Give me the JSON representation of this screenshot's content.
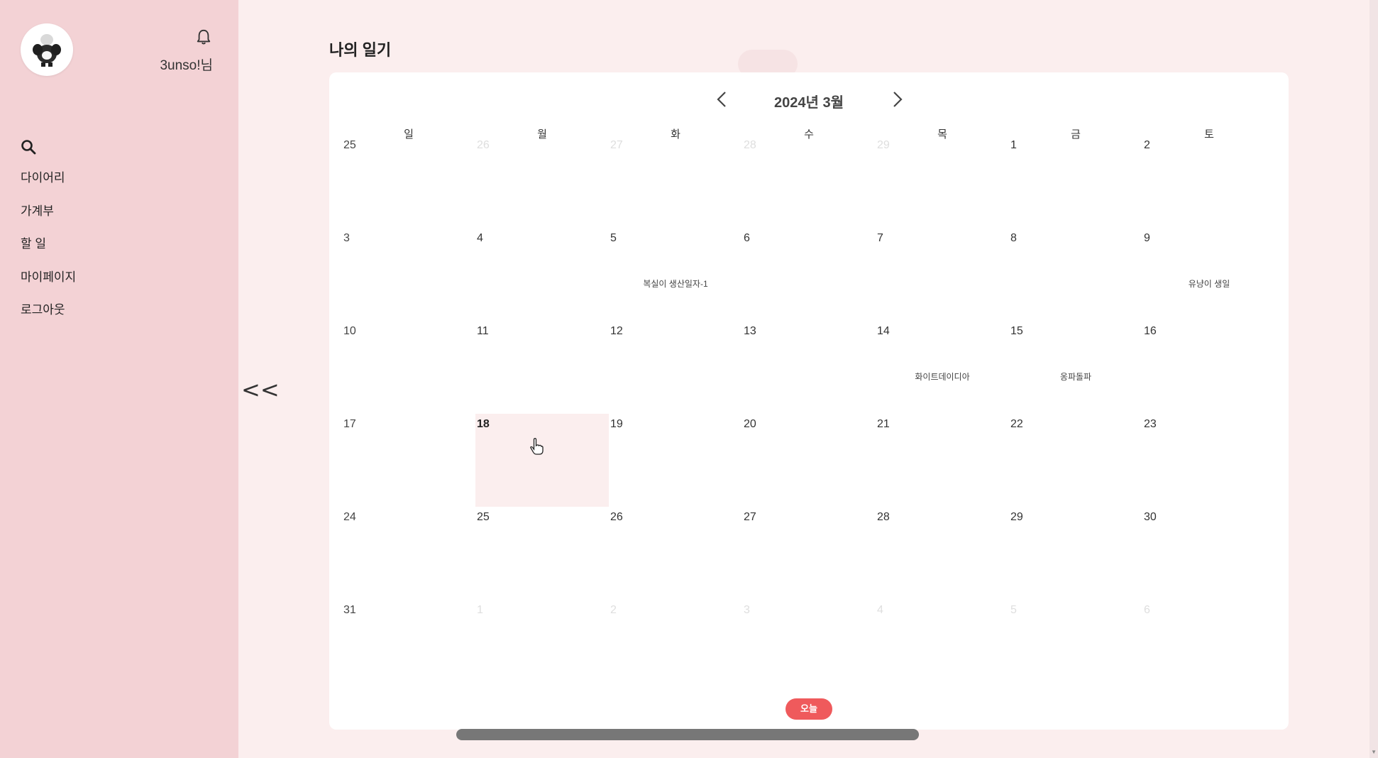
{
  "sidebar": {
    "username": "3unso!님",
    "menu": [
      {
        "label": "다이어리"
      },
      {
        "label": "가계부"
      },
      {
        "label": "할 일"
      },
      {
        "label": "마이페이지"
      },
      {
        "label": "로그아웃"
      }
    ]
  },
  "collapse_label": "<<",
  "page_title": "나의 일기",
  "calendar": {
    "month_label": "2024년 3월",
    "weekdays": [
      "일",
      "월",
      "화",
      "수",
      "목",
      "금",
      "토"
    ],
    "days": [
      {
        "d": "25",
        "muted": true
      },
      {
        "d": "26",
        "muted": true
      },
      {
        "d": "27",
        "muted": true
      },
      {
        "d": "28",
        "muted": true
      },
      {
        "d": "29",
        "muted": true
      },
      {
        "d": "1"
      },
      {
        "d": "2"
      },
      {
        "d": "3"
      },
      {
        "d": "4"
      },
      {
        "d": "5",
        "event": "복실이 생산일자-1"
      },
      {
        "d": "6"
      },
      {
        "d": "7"
      },
      {
        "d": "8"
      },
      {
        "d": "9",
        "event": "유냥이 생일"
      },
      {
        "d": "10"
      },
      {
        "d": "11"
      },
      {
        "d": "12"
      },
      {
        "d": "13"
      },
      {
        "d": "14",
        "event": "화이트데이디아"
      },
      {
        "d": "15",
        "event": "옹파돌파"
      },
      {
        "d": "16"
      },
      {
        "d": "17"
      },
      {
        "d": "18",
        "today": true
      },
      {
        "d": "19"
      },
      {
        "d": "20"
      },
      {
        "d": "21"
      },
      {
        "d": "22"
      },
      {
        "d": "23"
      },
      {
        "d": "24"
      },
      {
        "d": "25"
      },
      {
        "d": "26"
      },
      {
        "d": "27"
      },
      {
        "d": "28"
      },
      {
        "d": "29"
      },
      {
        "d": "30"
      },
      {
        "d": "31"
      },
      {
        "d": "1",
        "muted": true
      },
      {
        "d": "2",
        "muted": true
      },
      {
        "d": "3",
        "muted": true
      },
      {
        "d": "4",
        "muted": true
      },
      {
        "d": "5",
        "muted": true
      },
      {
        "d": "6",
        "muted": true
      }
    ],
    "today_label": "오늘"
  },
  "colors": {
    "sidebar_bg": "#f3d2d5",
    "page_bg": "#fbeeee",
    "accent": "#ef5a5c",
    "today_cell": "#fbeeee"
  }
}
